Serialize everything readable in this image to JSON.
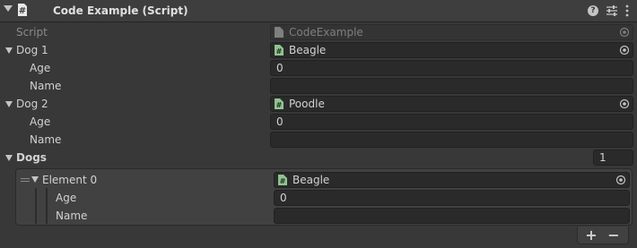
{
  "header": {
    "title": "Code Example (Script)",
    "help_symbol": "?",
    "icons": [
      "script-icon",
      "help-icon",
      "presets-icon",
      "kebab-menu-icon"
    ]
  },
  "script": {
    "label": "Script",
    "value": "CodeExample"
  },
  "dog1": {
    "label": "Dog 1",
    "value": "Beagle",
    "age_label": "Age",
    "age_value": "0",
    "name_label": "Name",
    "name_value": ""
  },
  "dog2": {
    "label": "Dog 2",
    "value": "Poodle",
    "age_label": "Age",
    "age_value": "0",
    "name_label": "Name",
    "name_value": ""
  },
  "dogs": {
    "label": "Dogs",
    "size": "1",
    "elements": [
      {
        "label": "Element 0",
        "value": "Beagle",
        "age_label": "Age",
        "age_value": "0",
        "name_label": "Name",
        "name_value": ""
      }
    ],
    "add_label": "+",
    "remove_label": "−"
  },
  "colors": {
    "background": "#383838",
    "field": "#2a2a2a",
    "text": "#d2d2d2",
    "script_icon_green": "#8fc48e"
  }
}
